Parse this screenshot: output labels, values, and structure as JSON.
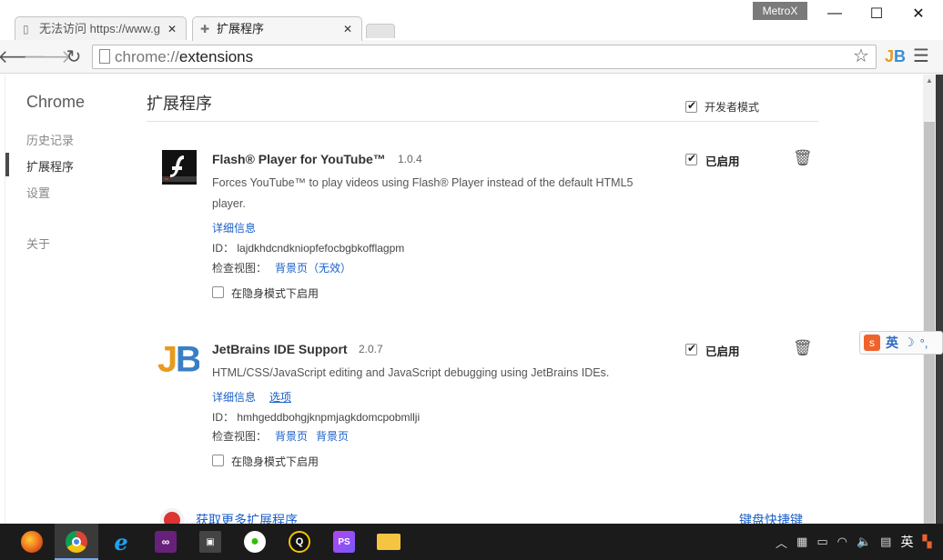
{
  "window": {
    "metrox_label": "MetroX",
    "minimize_glyph": "—",
    "maximize_glyph": "☐",
    "close_glyph": "✕"
  },
  "tabs": [
    {
      "title": "无法访问 https://www.g",
      "icon": "page-icon",
      "active": false
    },
    {
      "title": "扩展程序",
      "icon": "puzzle-icon",
      "active": true
    }
  ],
  "toolbar": {
    "url_scheme": "chrome://",
    "url_path": "extensions"
  },
  "sidebar": {
    "brand": "Chrome",
    "items": [
      {
        "label": "历史记录",
        "selected": false
      },
      {
        "label": "扩展程序",
        "selected": true
      },
      {
        "label": "设置",
        "selected": false
      },
      {
        "label": "关于",
        "selected": false
      }
    ]
  },
  "header": {
    "title": "扩展程序",
    "developer_mode_label": "开发者模式",
    "developer_mode_checked": true
  },
  "extensions": [
    {
      "name": "Flash® Player for YouTube™",
      "version": "1.0.4",
      "description": "Forces YouTube™ to play videos using Flash® Player instead of the default HTML5 player.",
      "details_link": "详细信息",
      "options_link": "",
      "id_label": "ID：",
      "id": "lajdkhdcndkniopfefocbgbkofflagpm",
      "inspect_label": "检查视图：",
      "inspect_views": [
        "背景页（无效）"
      ],
      "incognito_label": "在隐身模式下启用",
      "incognito_checked": false,
      "enabled_label": "已启用",
      "enabled_checked": true
    },
    {
      "name": "JetBrains IDE Support",
      "version": "2.0.7",
      "description": "HTML/CSS/JavaScript editing and JavaScript debugging using JetBrains IDEs.",
      "details_link": "详细信息",
      "options_link": "选项",
      "id_label": "ID：",
      "id": "hmhgeddbohgjknpmjagkdomcpobmllji",
      "inspect_label": "检查视图：",
      "inspect_views": [
        "背景页",
        "背景页"
      ],
      "incognito_label": "在隐身模式下启用",
      "incognito_checked": false,
      "enabled_label": "已启用",
      "enabled_checked": true
    }
  ],
  "footer": {
    "more_extensions_link": "获取更多扩展程序",
    "keyboard_shortcuts_link": "键盘快捷键"
  },
  "ime": {
    "lang": "英"
  },
  "taskbar": {
    "apps": [
      "firefox-icon",
      "chrome-icon",
      "ie-icon",
      "visual-studio-icon",
      "game-icon",
      "wechat-icon",
      "qq-icon",
      "phpstorm-icon",
      "file-explorer-icon"
    ],
    "tray_lang": "英"
  },
  "colors": {
    "link": "#1a60c8",
    "taskbar": "#1b1b1b"
  }
}
